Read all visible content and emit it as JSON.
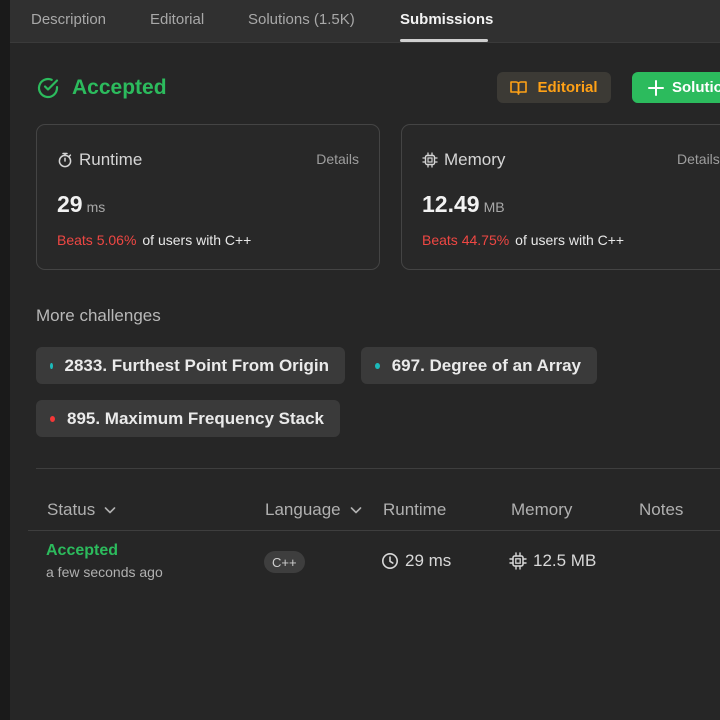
{
  "tabs": [
    {
      "label": "Description"
    },
    {
      "label": "Editorial"
    },
    {
      "label": "Solutions (1.5K)"
    },
    {
      "label": "Submissions"
    }
  ],
  "status": {
    "title": "Accepted",
    "color": "#2cbb5d"
  },
  "buttons": {
    "editorial": "Editorial",
    "solution": "Solutio"
  },
  "runtime_card": {
    "title": "Runtime",
    "details": "Details",
    "value": "29",
    "unit": "ms",
    "beats": "Beats 5.06%",
    "beats_suffix": "of users with C++"
  },
  "memory_card": {
    "title": "Memory",
    "details": "Details",
    "value": "12.49",
    "unit": "MB",
    "beats": "Beats 44.75%",
    "beats_suffix": "of users with C++"
  },
  "challenges": {
    "title": "More challenges",
    "items": [
      {
        "label": "2833. Furthest Point From Origin",
        "dot_color": "#1cbaba"
      },
      {
        "label": "697. Degree of an Array",
        "dot_color": "#1cbaba"
      },
      {
        "label": "895. Maximum Frequency Stack",
        "dot_color": "#f63737"
      }
    ]
  },
  "table": {
    "headers": {
      "status": "Status",
      "language": "Language",
      "runtime": "Runtime",
      "memory": "Memory",
      "notes": "Notes"
    },
    "rows": [
      {
        "status": "Accepted",
        "time": "a few seconds ago",
        "language": "C++",
        "runtime": "29 ms",
        "memory": "12.5 MB"
      }
    ]
  }
}
